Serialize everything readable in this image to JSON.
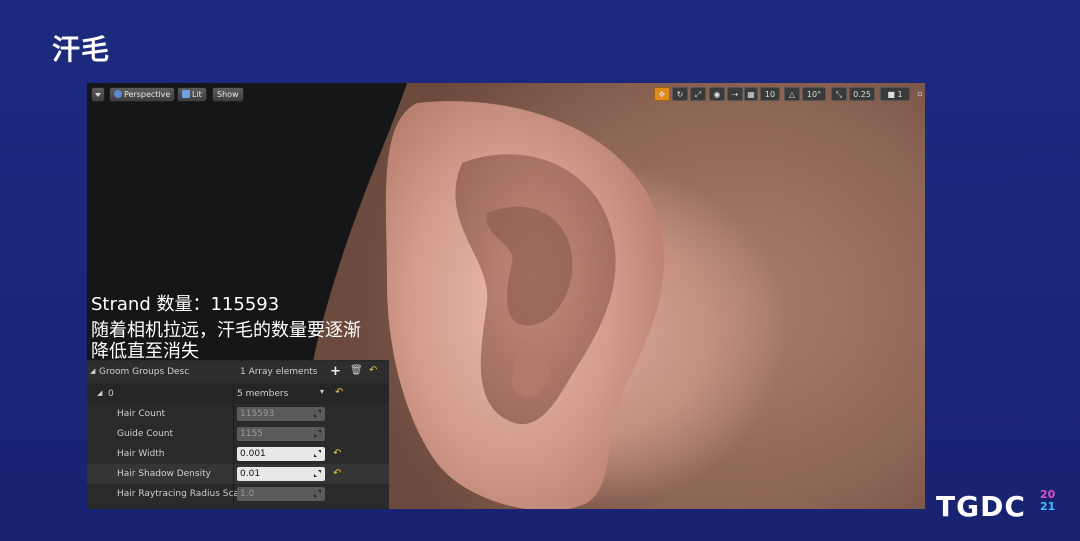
{
  "slide": {
    "title": "汗毛",
    "overlay_line1": "Strand 数量：115593",
    "overlay_line2": "随着相机拉远，汗毛的数量要逐渐",
    "overlay_line3": "降低直至消失"
  },
  "viewport_toolbar": {
    "perspective": "Perspective",
    "lit": "Lit",
    "show": "Show",
    "grid_value": "10",
    "angle_value": "10°",
    "scale_value": "0.25",
    "camera_speed": "1"
  },
  "panel": {
    "header_label": "Groom Groups Desc",
    "header_value": "1 Array elements",
    "group_index": "0",
    "group_members": "5 members",
    "rows": [
      {
        "label": "Hair Count",
        "value": "115593"
      },
      {
        "label": "Guide Count",
        "value": "1155"
      },
      {
        "label": "Hair Width",
        "value": "0.001"
      },
      {
        "label": "Hair Shadow Density",
        "value": "0.01"
      },
      {
        "label": "Hair Raytracing Radius Sca",
        "value": "1.0"
      }
    ]
  },
  "logo": {
    "text": "TGDC",
    "year_top": "20",
    "year_bottom": "21"
  },
  "colors": {
    "background": "#1b2879",
    "panel": "#2a2a2a",
    "accent_reset": "#e0c040",
    "logo_year_top": "#e050c0",
    "logo_year_bottom": "#40c0ff"
  }
}
